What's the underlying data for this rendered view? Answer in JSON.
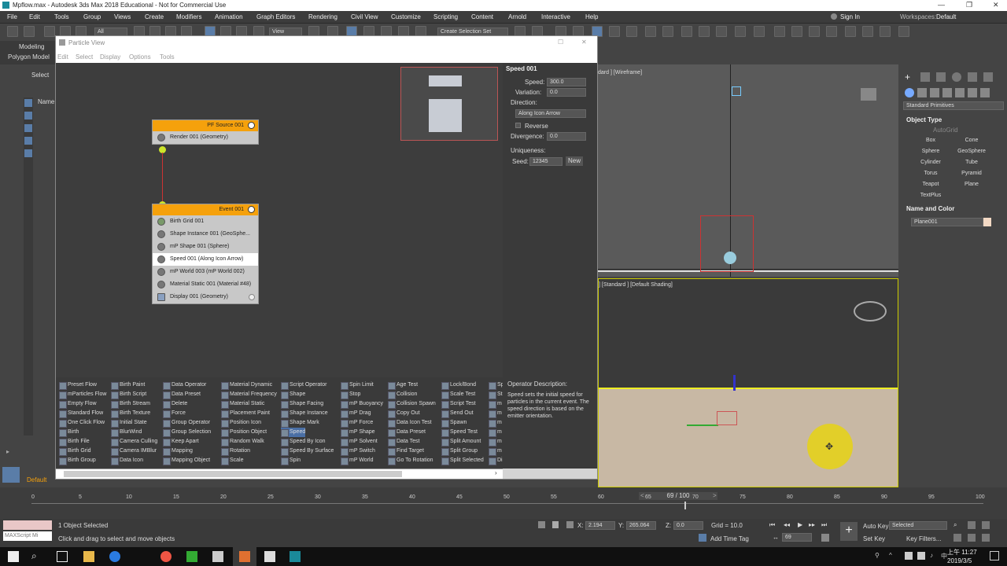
{
  "window": {
    "title": "Mpflow.max - Autodesk 3ds Max 2018 Educational - Not for Commercial Use"
  },
  "menu": [
    "File",
    "Edit",
    "Tools",
    "Group",
    "Views",
    "Create",
    "Modifiers",
    "Animation",
    "Graph Editors",
    "Rendering",
    "Civil View",
    "Customize",
    "Scripting",
    "Content",
    "Arnold",
    "Interactive",
    "Help"
  ],
  "account": {
    "sign_in": "Sign In",
    "workspaces_label": "Workspaces:",
    "workspace": "Default"
  },
  "toolbar": {
    "filter": "All",
    "view": "View",
    "selection_set": "Create Selection Set"
  },
  "ribbon": {
    "modeling": "Modeling",
    "polygon": "Polygon Model"
  },
  "scene_explorer": {
    "select": "Select",
    "name_col": "Name",
    "default": "Default"
  },
  "particle_view": {
    "title": "Particle View",
    "menu": [
      "Edit",
      "Select",
      "Display",
      "Options",
      "Tools"
    ],
    "source_node": {
      "title": "PF Source 001",
      "ops": [
        "Render 001 (Geometry)"
      ]
    },
    "event_node": {
      "title": "Event 001",
      "ops": [
        "Birth Grid 001",
        "Shape Instance 001 (GeoSphe...",
        "mP Shape 001 (Sphere)",
        "Speed 001 (Along Icon Arrow)",
        "mP World 003 (mP World 002)",
        "Material Static 001 (Material #48)",
        "Display 001 (Geometry)"
      ]
    },
    "params": {
      "title": "Speed 001",
      "speed_label": "Speed:",
      "speed": "300.0",
      "variation_label": "Variation:",
      "variation": "0.0",
      "direction_label": "Direction:",
      "direction": "Along Icon Arrow",
      "reverse": "Reverse",
      "divergence_label": "Divergence:",
      "divergence": "0.0",
      "uniqueness_label": "Uniqueness:",
      "seed_label": "Seed:",
      "seed": "12345",
      "new_btn": "New"
    },
    "description": {
      "title": "Operator Description:",
      "text": "Speed sets the initial speed for particles in the current event. The speed direction is based on the emitter orientation."
    },
    "depot": [
      [
        "Preset Flow",
        "mParticles Flow",
        "Empty Flow",
        "Standard Flow",
        "One Click Flow",
        "Birth",
        "Birth File",
        "Birth Grid",
        "Birth Group"
      ],
      [
        "Birth Paint",
        "Birth Script",
        "Birth Stream",
        "Birth Texture",
        "Initial State",
        "BlurWind",
        "Camera Culling",
        "Camera IMBlur",
        "Data Icon"
      ],
      [
        "Data Operator",
        "Data Preset",
        "Delete",
        "Force",
        "Group Operator",
        "Group Selection",
        "Keep Apart",
        "Mapping",
        "Mapping Object"
      ],
      [
        "Material Dynamic",
        "Material Frequency",
        "Material Static",
        "Placement Paint",
        "Position Icon",
        "Position Object",
        "Random Walk",
        "Rotation",
        "Scale"
      ],
      [
        "Script Operator",
        "Shape",
        "Shape Facing",
        "Shape Instance",
        "Shape Mark",
        "Speed",
        "Speed By Icon",
        "Speed By Surface",
        "Spin"
      ],
      [
        "Spin Limit",
        "Stop",
        "mP Buoyancy",
        "mP Drag",
        "mP Force",
        "mP Shape",
        "mP Solvent",
        "mP Switch",
        "mP World"
      ],
      [
        "Age Test",
        "Collision",
        "Collision Spawn",
        "Copy Out",
        "Data Icon Test",
        "Data Preset",
        "Data Test",
        "Find Target",
        "Go To Rotation"
      ],
      [
        "Lock/Bond",
        "Scale Test",
        "Script Test",
        "Send Out",
        "Spawn",
        "Speed Test",
        "Split Amount",
        "Split Group",
        "Split Selected"
      ],
      [
        "Sp",
        "St",
        "m",
        "m",
        "m",
        "m",
        "m",
        "m",
        "Di"
      ]
    ]
  },
  "viewports": {
    "top_label": "dard ] [Wireframe]",
    "persp_label": "] [Standard ] [Default Shading]"
  },
  "command_panel": {
    "category": "Standard Primitives",
    "object_type": "Object Type",
    "autogrid": "AutoGrid",
    "buttons": [
      "Box",
      "Cone",
      "Sphere",
      "GeoSphere",
      "Cylinder",
      "Tube",
      "Torus",
      "Pyramid",
      "Teapot",
      "Plane",
      "TextPlus"
    ],
    "name_color": "Name and Color",
    "object_name": "Plane001"
  },
  "timeline": {
    "frame": "69 / 100",
    "ticks": [
      "0",
      "5",
      "10",
      "15",
      "20",
      "25",
      "30",
      "35",
      "40",
      "45",
      "50",
      "55",
      "60",
      "65",
      "70",
      "75",
      "80",
      "85",
      "90",
      "95",
      "100"
    ]
  },
  "status": {
    "maxscript": "MAXScript Mi",
    "selected": "1 Object Selected",
    "prompt": "Click and drag to select and move objects",
    "x_label": "X:",
    "x": "2.194",
    "y_label": "Y:",
    "y": "265.064",
    "z_label": "Z:",
    "z": "0.0",
    "grid": "Grid = 10.0",
    "add_time_tag": "Add Time Tag",
    "auto_key": "Auto Key",
    "selected_dd": "Selected",
    "set_key": "Set Key",
    "key_filters": "Key Filters...",
    "current_frame": "69"
  },
  "taskbar": {
    "time": "上午 11:27",
    "date": "2019/3/5"
  },
  "colors": {
    "accent": "#f5a10c",
    "selection": "#4a6fa5",
    "viewport_floor": "#c8b8a4"
  }
}
